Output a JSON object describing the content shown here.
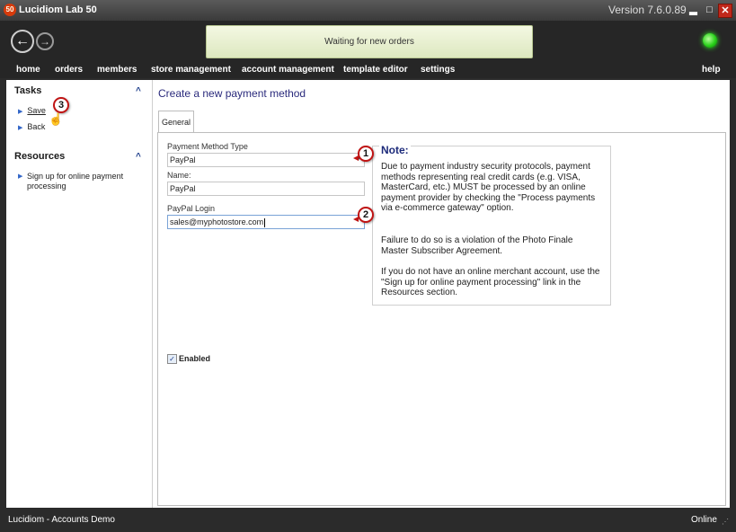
{
  "window": {
    "logo_text": "50",
    "title": "Lucidiom Lab 50",
    "version": "Version 7.6.0.89",
    "min_glyph": "▂",
    "max_glyph": "□",
    "close_glyph": "✕"
  },
  "toolbar": {
    "back_icon": "←",
    "forward_icon": "→",
    "status_message": "Waiting for new orders",
    "connection_led_color": "#29d11a"
  },
  "menu": {
    "items": [
      "home",
      "orders",
      "members",
      "store management",
      "account management",
      "template editor",
      "settings"
    ],
    "help": "help"
  },
  "sidebar": {
    "tasks_header": "Tasks",
    "tasks": [
      "Save",
      "Back"
    ],
    "resources_header": "Resources",
    "resources": [
      "Sign up for online payment processing"
    ],
    "collapse_glyph": "^"
  },
  "main": {
    "title": "Create a new payment method",
    "tab": "General",
    "type_label": "Payment Method Type",
    "type_value": "PayPal",
    "name_label": "Name:",
    "name_value": "PayPal",
    "login_label": "PayPal Login",
    "login_value": "sales@myphotostore.com",
    "enabled_label": "Enabled",
    "enabled_checked": true
  },
  "note": {
    "title": "Note:",
    "paragraphs": [
      "Due to payment industry security protocols, payment methods representing real credit cards (e.g. VISA, MasterCard, etc.) MUST be processed by an online payment provider by checking the \"Process payments via e-commerce gateway\" option.",
      "Failure to do so is a violation of the Photo Finale Master Subscriber Agreement.",
      "If you do not have an online merchant account, use the \"Sign up for online payment processing\" link in the Resources section."
    ]
  },
  "markers": [
    "1",
    "2",
    "3"
  ],
  "statusbar": {
    "left": "Lucidiom - Accounts Demo",
    "right": "Online"
  }
}
